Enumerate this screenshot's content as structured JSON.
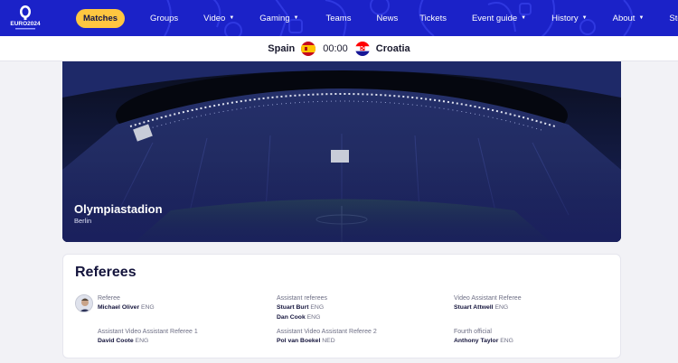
{
  "nav": {
    "logo_text": "EURO2024",
    "items": [
      {
        "label": "Matches",
        "active": true,
        "caret": false
      },
      {
        "label": "Groups",
        "active": false,
        "caret": false
      },
      {
        "label": "Video",
        "active": false,
        "caret": true
      },
      {
        "label": "Gaming",
        "active": false,
        "caret": true
      },
      {
        "label": "Teams",
        "active": false,
        "caret": false
      },
      {
        "label": "News",
        "active": false,
        "caret": false
      },
      {
        "label": "Tickets",
        "active": false,
        "caret": false
      },
      {
        "label": "Event guide",
        "active": false,
        "caret": true
      },
      {
        "label": "History",
        "active": false,
        "caret": true
      },
      {
        "label": "About",
        "active": false,
        "caret": true
      },
      {
        "label": "Store",
        "active": false,
        "caret": false
      }
    ],
    "caret_glyph": "▼"
  },
  "match": {
    "home_team": "Spain",
    "away_team": "Croatia",
    "time": "00:00"
  },
  "stadium": {
    "name": "Olympiastadion",
    "city": "Berlin"
  },
  "referees": {
    "title": "Referees",
    "referee": {
      "role": "Referee",
      "people": [
        {
          "name": "Michael Oliver",
          "nat": "ENG"
        }
      ]
    },
    "assistant_referees": {
      "role": "Assistant referees",
      "people": [
        {
          "name": "Stuart Burt",
          "nat": "ENG"
        },
        {
          "name": "Dan Cook",
          "nat": "ENG"
        }
      ]
    },
    "var": {
      "role": "Video Assistant Referee",
      "people": [
        {
          "name": "Stuart Attwell",
          "nat": "ENG"
        }
      ]
    },
    "avar1": {
      "role": "Assistant Video Assistant Referee 1",
      "people": [
        {
          "name": "David Coote",
          "nat": "ENG"
        }
      ]
    },
    "avar2": {
      "role": "Assistant Video Assistant Referee 2",
      "people": [
        {
          "name": "Pol van Boekel",
          "nat": "NED"
        }
      ]
    },
    "fourth": {
      "role": "Fourth official",
      "people": [
        {
          "name": "Anthony Taylor",
          "nat": "ENG"
        }
      ]
    }
  },
  "colors": {
    "nav_bg": "#1b22c8",
    "active_pill": "#ffc640"
  }
}
